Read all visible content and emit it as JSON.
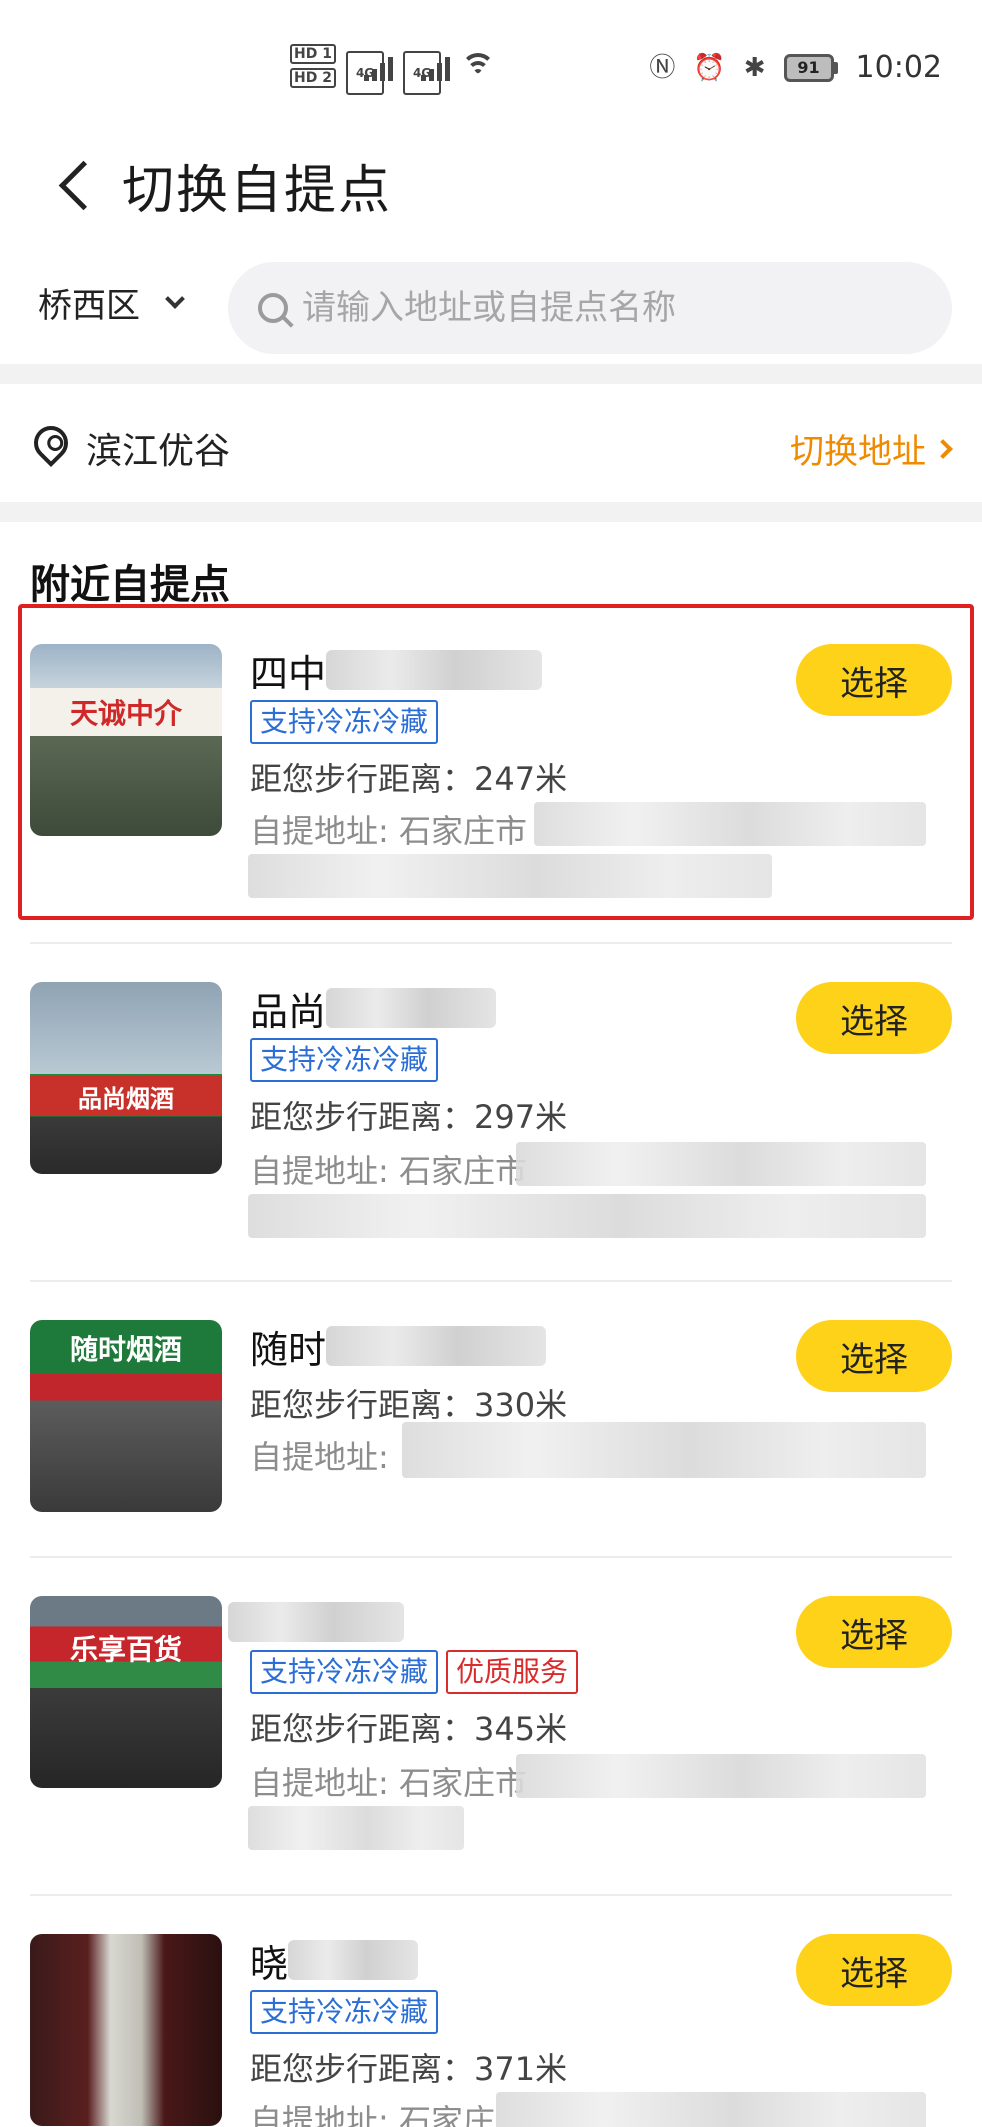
{
  "status_bar": {
    "hd1": "HD 1",
    "hd2": "HD 2",
    "sig1_tag": "4G",
    "sig2_tag": "4G",
    "battery": "91",
    "time": "10:02"
  },
  "header": {
    "title": "切换自提点"
  },
  "search": {
    "district": "桥西区",
    "placeholder": "请输入地址或自提点名称"
  },
  "location": {
    "name": "滨江优谷",
    "switch_label": "切换地址"
  },
  "section_title": "附近自提点",
  "pickup_points": [
    {
      "name_visible": "四中",
      "tags": [
        "支持冷冻冷藏"
      ],
      "distance": "距您步行距离：247米",
      "address": "自提地址: 石家庄市",
      "select_label": "选择",
      "thumb_text": "天诚中介",
      "selected": true
    },
    {
      "name_visible": "品尚",
      "tags": [
        "支持冷冻冷藏"
      ],
      "distance": "距您步行距离：297米",
      "address": "自提地址: 石家庄市",
      "select_label": "选择",
      "thumb_text": "品尚烟酒",
      "selected": false
    },
    {
      "name_visible": "随时",
      "tags": [],
      "distance": "距您步行距离：330米",
      "address": "自提地址:",
      "select_label": "选择",
      "thumb_text": "随时烟酒",
      "selected": false
    },
    {
      "name_visible": "",
      "tags": [
        "支持冷冻冷藏",
        "优质服务"
      ],
      "distance": "距您步行距离：345米",
      "address": "自提地址: 石家庄市",
      "select_label": "选择",
      "thumb_text": "乐享百货",
      "selected": false
    },
    {
      "name_visible": "晓",
      "tags": [
        "支持冷冻冷藏"
      ],
      "distance": "距您步行距离：371米",
      "address": "自提地址: 石家庄",
      "select_label": "选择",
      "thumb_text": "",
      "selected": false
    }
  ],
  "colors": {
    "accent_orange": "#f08a00",
    "button_yellow": "#ffd21a",
    "tag_blue": "#2b6fd6",
    "tag_red": "#d92d2d",
    "highlight_red": "#e02020"
  }
}
